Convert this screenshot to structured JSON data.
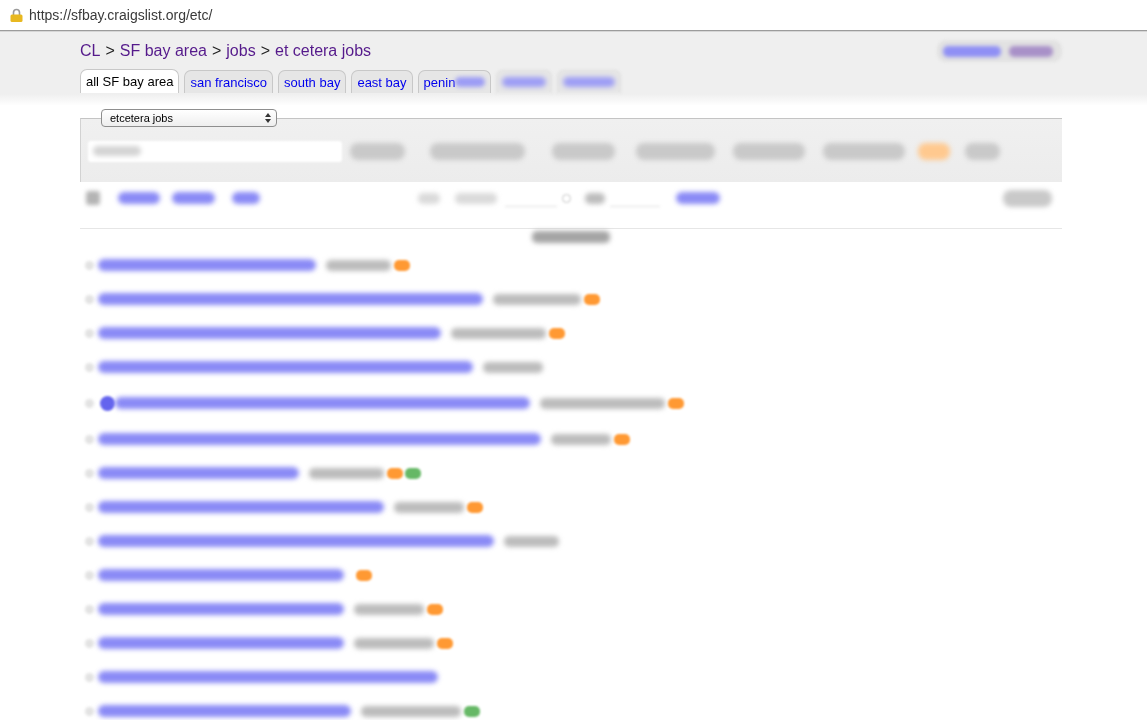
{
  "browser": {
    "url": "https://sfbay.craigslist.org/etc/"
  },
  "breadcrumb": {
    "links": [
      "CL",
      "SF bay area",
      "jobs",
      "et cetera jobs"
    ],
    "separators": [
      ">",
      ">",
      ">"
    ]
  },
  "area_tabs": [
    {
      "kind": "text",
      "label": "all SF bay area",
      "selected": true
    },
    {
      "kind": "text",
      "label": "san francisco",
      "selected": false
    },
    {
      "kind": "text",
      "label": "south bay",
      "selected": false
    },
    {
      "kind": "text",
      "label": "east bay",
      "selected": false
    },
    {
      "kind": "partly_blurred",
      "label": "penin",
      "selected": false
    },
    {
      "kind": "blurred",
      "selected": false
    },
    {
      "kind": "blurred",
      "selected": false
    }
  ],
  "search": {
    "category": "etcetera jobs"
  },
  "listings": [
    {
      "icon": false,
      "tags": [
        {
          "color": "#ff9933"
        }
      ]
    },
    {
      "icon": false,
      "tags": [
        {
          "color": "#ff9933"
        }
      ]
    },
    {
      "icon": false,
      "tags": [
        {
          "color": "#ff9933"
        }
      ]
    },
    {
      "icon": false
    },
    {
      "icon": true,
      "tags": [
        {
          "color": "#ff9933"
        }
      ]
    },
    {
      "icon": false,
      "tags": [
        {
          "color": "#ff9933"
        }
      ]
    },
    {
      "icon": false,
      "tags": [
        {
          "color": "#ff9933"
        },
        {
          "color": "#66b866"
        }
      ]
    },
    {
      "icon": false,
      "tags": [
        {
          "color": "#ff9933"
        }
      ]
    },
    {
      "icon": false
    },
    {
      "icon": false,
      "tags": [
        {
          "color": "#ff9933"
        }
      ]
    },
    {
      "icon": false,
      "tags": [
        {
          "color": "#ff9933"
        }
      ]
    },
    {
      "icon": false,
      "tags": [
        {
          "color": "#ff9933"
        }
      ]
    },
    {
      "icon": false
    },
    {
      "icon": false,
      "tags": [
        {
          "color": "#66b866"
        }
      ]
    }
  ]
}
